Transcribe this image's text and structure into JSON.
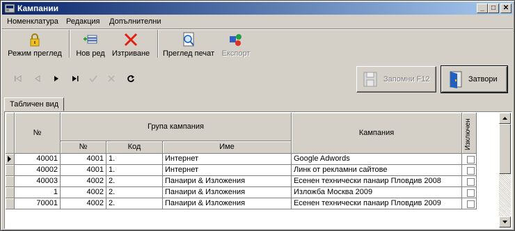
{
  "window": {
    "title": "Кампании"
  },
  "menu": [
    "Номенклатура",
    "Редакция",
    "Допълнителни"
  ],
  "toolbar": {
    "view_mode": "Режим преглед",
    "new_row": "Нов ред",
    "delete": "Изтриване",
    "print_preview": "Преглед печат",
    "export": "Експорт"
  },
  "buttons": {
    "save": "Запомни  F12",
    "close": "Затвори"
  },
  "tab": "Табличен вид",
  "grid": {
    "headers": {
      "number": "№",
      "group": "Група кампания",
      "group_number": "№",
      "group_code": "Код",
      "group_name": "Име",
      "campaign": "Кампания",
      "excluded": "Изключен"
    },
    "rows": [
      {
        "num": "40001",
        "gnum": "4001",
        "code": "1.",
        "name": "Интернет",
        "campaign": "Google Adwords",
        "current": true
      },
      {
        "num": "40002",
        "gnum": "4001",
        "code": "1.",
        "name": "Интернет",
        "campaign": "Линк от рекламни сайтове",
        "current": false
      },
      {
        "num": "40003",
        "gnum": "4002",
        "code": "2.",
        "name": "Панаири & Изложения",
        "campaign": "Есенен технически панаир Пловдив 2008",
        "current": false
      },
      {
        "num": "1",
        "gnum": "4002",
        "code": "2.",
        "name": "Панаири & Изложения",
        "campaign": "Изложба Москва 2009",
        "current": false
      },
      {
        "num": "70001",
        "gnum": "4002",
        "code": "2.",
        "name": "Панаири & Изложения",
        "campaign": "Есенен технически панаир Пловдив 2009",
        "current": false
      }
    ]
  }
}
